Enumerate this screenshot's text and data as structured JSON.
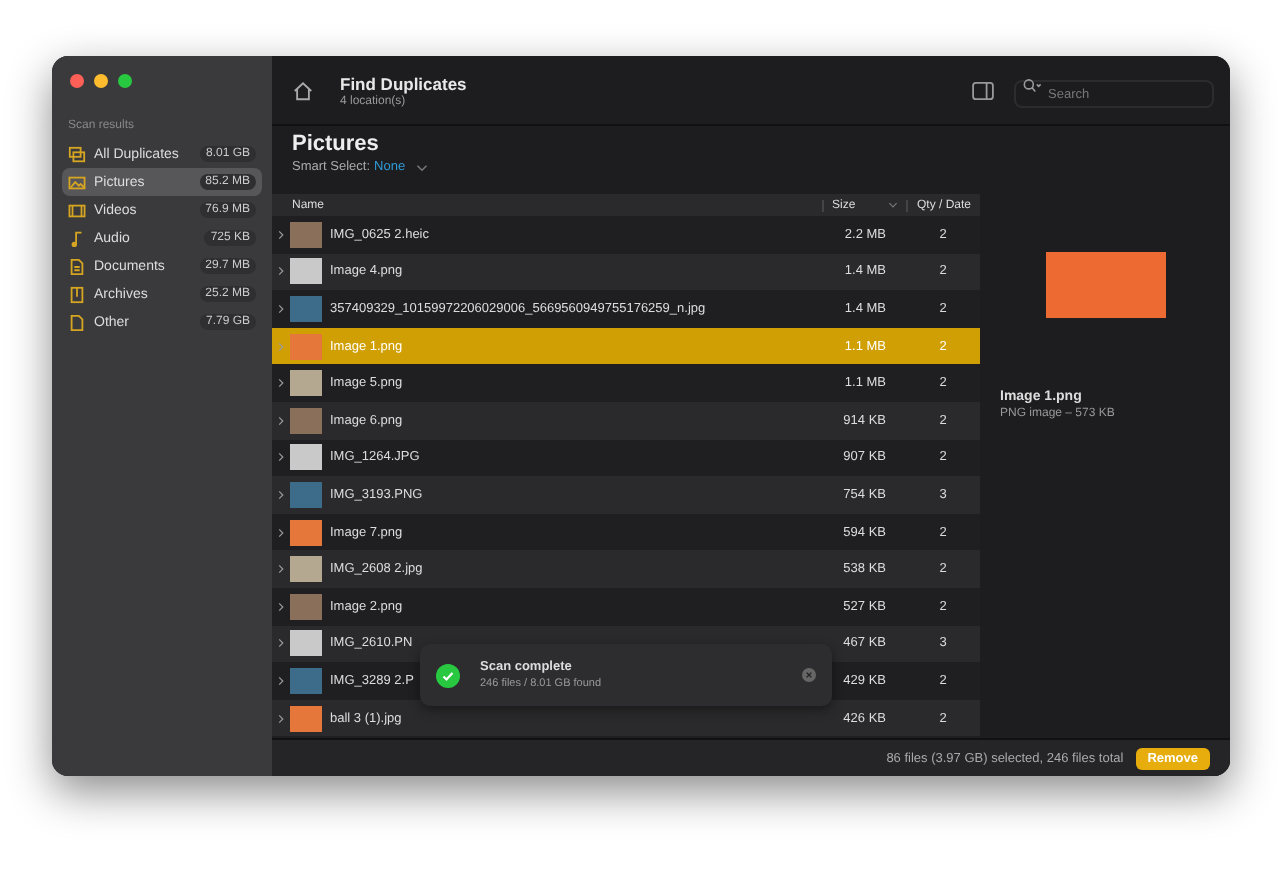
{
  "sidebar": {
    "heading": "Scan results",
    "items": [
      {
        "kind": "all",
        "label": "All Duplicates",
        "size": "8.01 GB",
        "selected": false
      },
      {
        "kind": "pictures",
        "label": "Pictures",
        "size": "85.2 MB",
        "selected": true
      },
      {
        "kind": "videos",
        "label": "Videos",
        "size": "76.9 MB",
        "selected": false
      },
      {
        "kind": "audio",
        "label": "Audio",
        "size": "725 KB",
        "selected": false
      },
      {
        "kind": "documents",
        "label": "Documents",
        "size": "29.7 MB",
        "selected": false
      },
      {
        "kind": "archives",
        "label": "Archives",
        "size": "25.2 MB",
        "selected": false
      },
      {
        "kind": "other",
        "label": "Other",
        "size": "7.79 GB",
        "selected": false
      }
    ]
  },
  "toolbar": {
    "title": "Find Duplicates",
    "subtitle": "4 location(s)",
    "search": {
      "placeholder": "Search"
    }
  },
  "section": {
    "title": "Pictures",
    "smart_select_label": "Smart Select:",
    "smart_select_value": "None"
  },
  "table": {
    "columns": [
      "Name",
      "Size",
      "Qty / Date"
    ],
    "rows": [
      {
        "name": "IMG_0625 2.heic",
        "size": "2.2 MB",
        "qty": "2",
        "selected": false
      },
      {
        "name": "Image 4.png",
        "size": "1.4 MB",
        "qty": "2",
        "selected": false
      },
      {
        "name": "357409329_10159972206029006_5669560949755176259_n.jpg",
        "size": "1.4 MB",
        "qty": "2",
        "selected": false
      },
      {
        "name": "Image 1.png",
        "size": "1.1 MB",
        "qty": "2",
        "selected": true
      },
      {
        "name": "Image 5.png",
        "size": "1.1 MB",
        "qty": "2",
        "selected": false
      },
      {
        "name": "Image 6.png",
        "size": "914 KB",
        "qty": "2",
        "selected": false
      },
      {
        "name": "IMG_1264.JPG",
        "size": "907 KB",
        "qty": "2",
        "selected": false
      },
      {
        "name": "IMG_3193.PNG",
        "size": "754 KB",
        "qty": "3",
        "selected": false
      },
      {
        "name": "Image 7.png",
        "size": "594 KB",
        "qty": "2",
        "selected": false
      },
      {
        "name": "IMG_2608 2.jpg",
        "size": "538 KB",
        "qty": "2",
        "selected": false
      },
      {
        "name": "Image 2.png",
        "size": "527 KB",
        "qty": "2",
        "selected": false
      },
      {
        "name": "IMG_2610.PN",
        "size": "467 KB",
        "qty": "3",
        "selected": false
      },
      {
        "name": "IMG_3289 2.P",
        "size": "429 KB",
        "qty": "2",
        "selected": false
      },
      {
        "name": "ball 3 (1).jpg",
        "size": "426 KB",
        "qty": "2",
        "selected": false
      }
    ]
  },
  "preview": {
    "name": "Image 1.png",
    "info": "PNG image – 573 KB"
  },
  "toast": {
    "title": "Scan complete",
    "message": "246 files / 8.01 GB found"
  },
  "status_bar": {
    "text": "86 files (3.97 GB) selected, 246 files total",
    "button": "Remove"
  }
}
